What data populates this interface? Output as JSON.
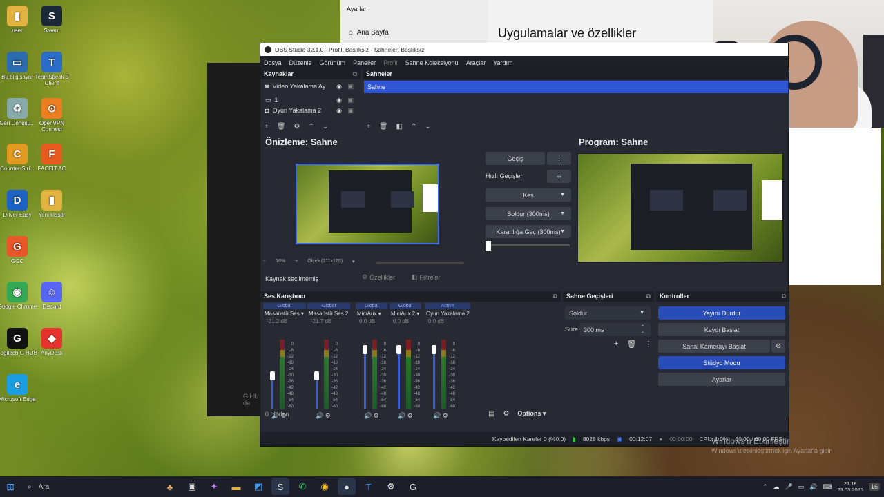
{
  "desktop": {
    "icons": [
      {
        "label": "user",
        "icon": "folder-user-icon",
        "color": "#e3b341",
        "glyph": "▮"
      },
      {
        "label": "Steam",
        "icon": "steam-icon",
        "color": "#1b2838",
        "glyph": "S"
      },
      {
        "label": "Bu bilgisayar",
        "icon": "computer-icon",
        "color": "#2b6cb0",
        "glyph": "▭"
      },
      {
        "label": "TeamSpeak 3 Client",
        "icon": "teamspeak-icon",
        "color": "#2a6cc8",
        "glyph": "T"
      },
      {
        "label": "Geri Dönüşü...",
        "icon": "recycle-bin-icon",
        "color": "#8aa",
        "glyph": "♻"
      },
      {
        "label": "OpenVPN Connect",
        "icon": "openvpn-icon",
        "color": "#ea7e20",
        "glyph": "⊙"
      },
      {
        "label": "Counter-Stri...",
        "icon": "counter-strike-icon",
        "color": "#e39a21",
        "glyph": "C"
      },
      {
        "label": "FACEIT AC",
        "icon": "faceit-icon",
        "color": "#e85b20",
        "glyph": "F"
      },
      {
        "label": "Driver Easy",
        "icon": "drivereasy-icon",
        "color": "#1c62c4",
        "glyph": "D"
      },
      {
        "label": "Yeni klasör",
        "icon": "folder-icon",
        "color": "#e3b341",
        "glyph": "▮"
      },
      {
        "label": "GGC",
        "icon": "ggc-icon",
        "color": "#e8572a",
        "glyph": "G"
      },
      {
        "label": "Google Chrome",
        "icon": "chrome-icon",
        "color": "#34a853",
        "glyph": "◉"
      },
      {
        "label": "Discord",
        "icon": "discord-icon",
        "color": "#5865f2",
        "glyph": "☺"
      },
      {
        "label": "Logitech G HUB",
        "icon": "logitech-ghub-icon",
        "color": "#111",
        "glyph": "G"
      },
      {
        "label": "AnyDesk",
        "icon": "anydesk-icon",
        "color": "#e5322d",
        "glyph": "◆"
      },
      {
        "label": "Microsoft Edge",
        "icon": "edge-icon",
        "color": "#1b9de2",
        "glyph": "e"
      }
    ]
  },
  "settings_window": {
    "title": "Ayarlar",
    "nav_home": "Ana Sayfa",
    "heading": "Uygulamalar ve özellikler"
  },
  "behind_text": "G HU\nde",
  "obs": {
    "title": "OBS Studio 32.1.0 - Profil: Başlıksız - Sahneler: Başlıksız",
    "menu": [
      "Dosya",
      "Düzenle",
      "Görünüm",
      "Paneller",
      "Profil",
      "Sahne Koleksiyonu",
      "Araçlar",
      "Yardım"
    ],
    "sources_title": "Kaynaklar",
    "sources": [
      "Video Yakalama Ay",
      "1",
      "Oyun Yakalama 2"
    ],
    "scenes_title": "Sahneler",
    "scenes": [
      "Sahne"
    ],
    "preview_title": "Önizleme: Sahne",
    "program_title": "Program: Sahne",
    "transition_btn": "Geçiş",
    "quick_transitions_label": "Hızlı Geçişler",
    "quick": [
      "Kes",
      "Soldur (300ms)",
      "Karanlığa Geç (300ms)"
    ],
    "zoom_label": "16%",
    "scale_label": "Ölçek (311x175)",
    "no_source": "Kaynak seçilmemiş",
    "properties_btn": "Özellikler",
    "filters_btn": "Filtreler",
    "mixer_title": "Ses Karıştırıcı",
    "mixer": [
      {
        "tag": "Global",
        "name": "Masaüstü Ses",
        "db": "-21.2 dB",
        "level": 0.55
      },
      {
        "tag": "Global",
        "name": "Masaüstü Ses 2",
        "db": "-21.7 dB",
        "level": 0.55
      },
      {
        "tag": "Global",
        "name": "Mic/Aux",
        "db": "0.0 dB",
        "level": 1.0
      },
      {
        "tag": "Global",
        "name": "Mic/Aux 2",
        "db": "0.0 dB",
        "level": 1.0
      },
      {
        "tag": "Active",
        "name": "Oyun Yakalama 2",
        "db": "0.0 dB",
        "level": 1.0
      }
    ],
    "scale_ticks": [
      "0",
      "-6",
      "-12",
      "-18",
      "-24",
      "-30",
      "-36",
      "-42",
      "-48",
      "-54",
      "-60"
    ],
    "hidden_label": "0 hidden",
    "options_label": "Options",
    "transitions_title": "Sahne Geçişleri",
    "transition_select": "Soldur",
    "duration_label": "Süre",
    "duration_value": "300 ms",
    "controls_title": "Kontroller",
    "controls": [
      {
        "label": "Yayını Durdur",
        "active": true
      },
      {
        "label": "Kaydı Başlat",
        "active": false
      },
      {
        "label": "Sanal Kamerayı Başlat",
        "active": false
      },
      {
        "label": "Stüdyo Modu",
        "active": true
      },
      {
        "label": "Ayarlar",
        "active": false
      }
    ],
    "status": {
      "dropped": "Kaybedilen Kareler 0 (%0.0)",
      "bitrate": "8028 kbps",
      "stream_time": "00:12:07",
      "rec_time": "00:00:00",
      "cpu": "CPU: 1.0%",
      "fps": "60.00 / 60.00 FPS"
    }
  },
  "windows_watermark": {
    "line1": "Windows'u Etkinleştir",
    "line2": "Windows'u etkinleştirmek için Ayarlar'a gidin"
  },
  "taskbar": {
    "search": "Ara",
    "time": "21:18",
    "date": "23.03.2026",
    "notif": "16"
  }
}
